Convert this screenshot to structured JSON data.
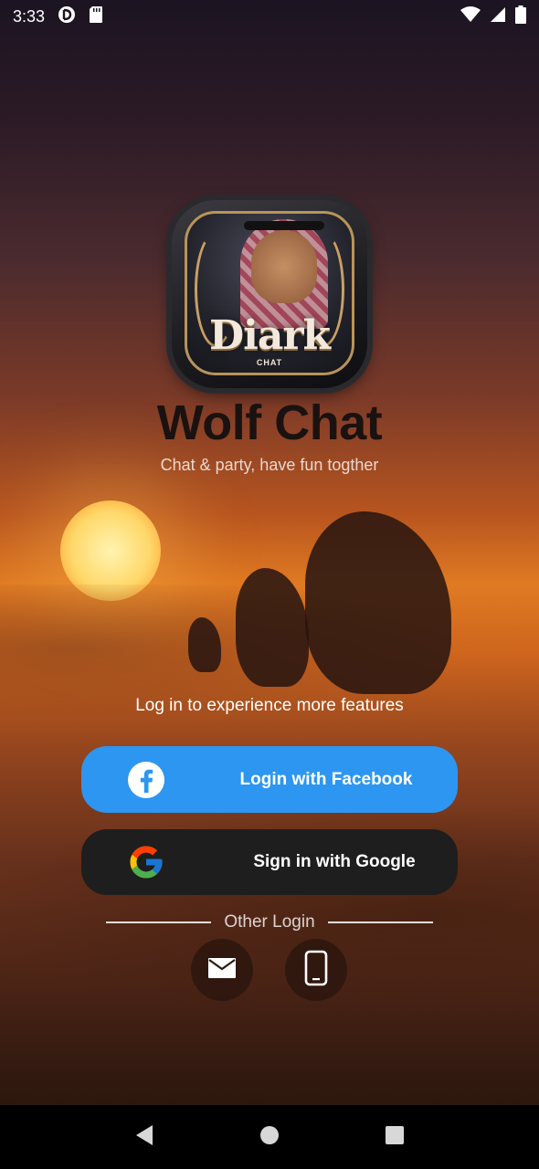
{
  "status_bar": {
    "time": "3:33",
    "icons": [
      "pocket-casts-icon",
      "sd-card-icon",
      "wifi-icon",
      "signal-icon",
      "battery-icon"
    ]
  },
  "app": {
    "logo_word": "Diark",
    "logo_sub": "CHAT",
    "title": "Wolf Chat",
    "tagline": "Chat & party, have fun togther"
  },
  "login": {
    "prompt": "Log in to experience more features",
    "facebook_label": "Login with Facebook",
    "google_label": "Sign in with Google",
    "other_login_label": "Other Login",
    "alternatives": [
      "email-icon",
      "phone-icon"
    ]
  },
  "colors": {
    "facebook_button": "#2d96f0",
    "google_button": "#1e1e1e",
    "title_text": "#1a1210"
  },
  "nav_bar": {
    "buttons": [
      "back-icon",
      "home-icon",
      "recents-icon"
    ]
  }
}
